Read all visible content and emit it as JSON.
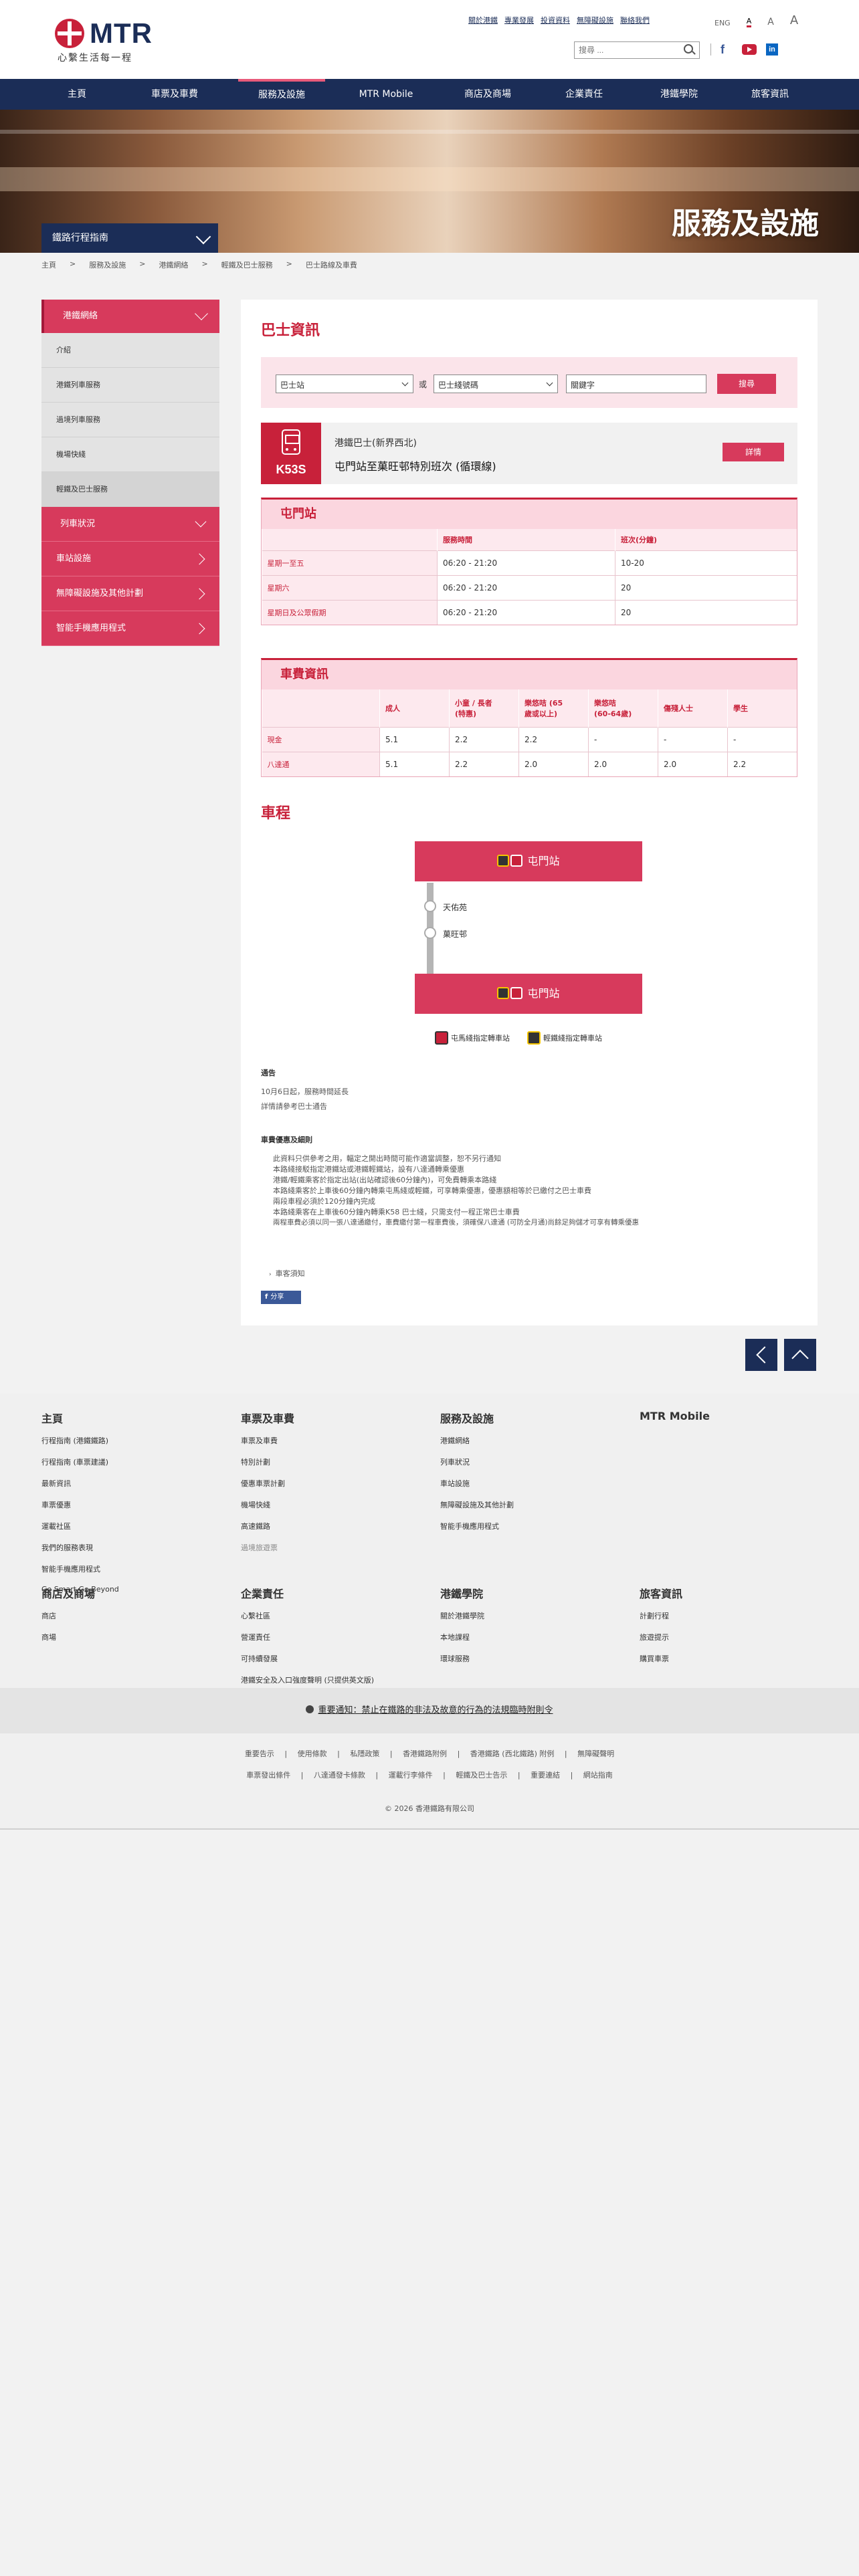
{
  "brand": {
    "logo": "MTR",
    "slogan": "心繫生活每一程"
  },
  "top_links": [
    "關於港鐵",
    "專業發展",
    "投資資料",
    "無障礙設施",
    "聯絡我們"
  ],
  "lang": {
    "eng": "ENG",
    "a1": "A",
    "a2": "A",
    "a3": "A"
  },
  "search": {
    "placeholder": "搜尋 ..."
  },
  "social": {
    "fb": "f",
    "li": "in"
  },
  "nav": [
    "主頁",
    "車票及車費",
    "服務及設施",
    "MTR Mobile",
    "商店及商場",
    "企業責任",
    "港鐵學院",
    "旅客資訊"
  ],
  "hero": {
    "title": "服務及設施",
    "trip_planner": "鐵路行程指南"
  },
  "breadcrumb": [
    "主頁",
    ">",
    "服務及設施",
    ">",
    "港鐵網絡",
    ">",
    "輕鐵及巴士服務",
    ">",
    "巴士路線及車費"
  ],
  "sidebar": {
    "head": "港鐵網絡",
    "subs": [
      "介紹",
      "港鐵列車服務",
      "過境列車服務",
      "機場快綫",
      "輕鐵及巴士服務"
    ],
    "mains": [
      "列車狀況",
      "車站設施",
      "無障礙設施及其他計劃",
      "智能手機應用程式"
    ]
  },
  "content": {
    "title": "巴士資訊",
    "filter": {
      "type": "巴士站",
      "or": "或",
      "route": "巴士綫號碼",
      "keyword": "關鍵字",
      "button": "搜尋"
    },
    "route": {
      "code": "K53S",
      "operator": "港鐵巴士(新界西北)",
      "name": "屯門站至菓旺邨特別班次 (循環線)",
      "details": "詳情"
    },
    "freq": {
      "caption": "屯門站",
      "headers": [
        "",
        "服務時間",
        "班次(分鐘)"
      ],
      "rows": [
        [
          "星期一至五",
          "06:20 - 21:20",
          "10-20"
        ],
        [
          "星期六",
          "06:20 - 21:20",
          "20"
        ],
        [
          "星期日及公眾假期",
          "06:20 - 21:20",
          "20"
        ]
      ]
    },
    "fare": {
      "caption": "車費資訊",
      "headers": [
        "",
        "成人",
        "小童 / 長者\n(特惠)",
        "樂悠咭 (65\n歲或以上)",
        "樂悠咭\n(60-64歲)",
        "傷殘人士",
        "學生"
      ],
      "rows": [
        [
          "現金",
          "5.1",
          "2.2",
          "2.2",
          "-",
          "-",
          "-"
        ],
        [
          "八達通",
          "5.1",
          "2.2",
          "2.0",
          "2.0",
          "2.0",
          "2.2"
        ]
      ]
    },
    "journey": {
      "title": "車程",
      "start": "屯門站",
      "stops": [
        "天佑苑",
        "菓旺邨"
      ],
      "end": "屯門站",
      "legend_red": "屯馬綫指定轉車站",
      "legend_dark": "輕鐵綫指定轉車站"
    },
    "notice_title": "通告",
    "notice_lines": [
      "10月6日起，服務時間延長",
      "詳情請參考巴士通告"
    ],
    "transfer_title": "車費優惠及細則",
    "transfer_lines": [
      "此資料只供參考之用，輻定之開出時間可能作適當調整，恕不另行通知",
      "本路綫接駁指定港鐵站或港鐵輕鐵站，設有八達通轉乘優惠",
      "港鐵/輕鐵乘客於指定出站(出站確認後60分鐘內)，可免費轉乘本路綫",
      "本路綫乘客於上車後60分鐘內轉乘屯馬綫或輕鐵，可享轉乘優惠，優惠額相等於已繳付之巴士車費",
      "兩段車程必須於120分鐘內完成",
      "本路綫乘客在上車後60分鐘內轉乘K58 巴士綫，只需支付一程正常巴士車費",
      "兩程車費必須以同一張八達通繳付，車費繳付第一程車費後，須確保八達通 (可防全月通)尚餘足夠儲才可享有轉乘優惠"
    ],
    "print": "車客須知",
    "share": "分享"
  },
  "footer": {
    "cols": [
      {
        "h": "主頁",
        "items": [
          "行程指南 (港鐵鐵路)",
          "行程指南 (車票建議)",
          "最新資訊",
          "車票優惠",
          "運載社區",
          "我們的服務表現",
          "智能手機應用程式",
          "Go Smart Go Beyond"
        ]
      },
      {
        "h": "車票及車費",
        "items": [
          "車票及車費",
          "特別計劃",
          "優惠車票計劃",
          "機場快綫",
          "高速鐵路",
          "過境旅遊票"
        ]
      },
      {
        "h": "服務及設施",
        "items": [
          "港鐵網絡",
          "列車狀況",
          "車站設施",
          "無障礙設施及其他計劃",
          "智能手機應用程式"
        ]
      },
      {
        "h": "MTR Mobile",
        "items": []
      },
      {
        "h": "商店及商場",
        "items": [
          "商店",
          "商場"
        ]
      },
      {
        "h": "企業責任",
        "items": [
          "心繫社區",
          "營運責任",
          "可持續發展",
          "港鐵安全及入口強度聲明 (只提供英文版)"
        ]
      },
      {
        "h": "港鐵學院",
        "items": [
          "關於港鐵學院",
          "本地課程",
          "環球服務"
        ]
      },
      {
        "h": "旅客資訊",
        "items": [
          "計劃行程",
          "旅遊提示",
          "購買車票"
        ]
      }
    ],
    "notice": "重要通知：禁止在鐵路的非法及故意的行為的法規臨時附則令",
    "links1": [
      "重要告示",
      "|",
      "使用條款",
      "|",
      "私隱政策",
      "|",
      "香港鐵路附例",
      "|",
      "香港鐵路 (西北鐵路) 附例",
      "|",
      "無障礙聲明"
    ],
    "links2": [
      "車票發出條件",
      "|",
      "八達通發卡條款",
      "|",
      "運載行李條件",
      "|",
      "輕鐵及巴士告示",
      "|",
      "重要連結",
      "|",
      "網站指南"
    ],
    "copyright": "© 2026 香港鐵路有限公司"
  }
}
